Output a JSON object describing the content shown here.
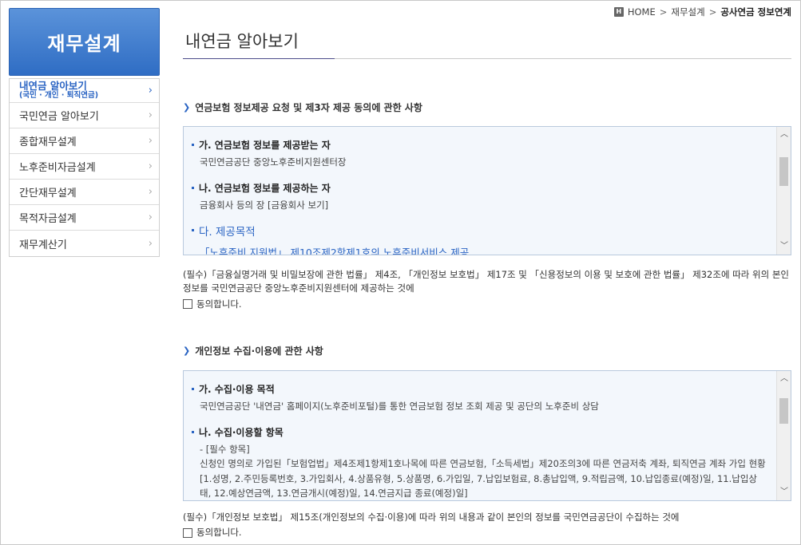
{
  "sidebar": {
    "title": "재무설계",
    "active_label": "내연금 알아보기",
    "active_sub": "(국민 · 개인 · 퇴직연금)",
    "items": [
      "국민연금 알아보기",
      "종합재무설계",
      "노후준비자금설계",
      "간단재무설계",
      "목적자금설계",
      "재무계산기"
    ]
  },
  "breadcrumb": {
    "home_icon": "H",
    "home": "HOME",
    "sep": ">",
    "level1": "재무설계",
    "current": "공사연금 정보연계"
  },
  "page": {
    "title": "내연금 알아보기"
  },
  "section1": {
    "heading": "연금보험 정보제공 요청 및 제3자 제공 동의에 관한 사항",
    "items": [
      {
        "head": "가. 연금보험 정보를 제공받는 자",
        "text": "국민연금공단 중앙노후준비지원센터장"
      },
      {
        "head": "나. 연금보험 정보를 제공하는 자",
        "text": "금융회사 등의 장 [금융회사 보기]"
      },
      {
        "head": "다. 제공목적",
        "text": "「노후준비 지원법」 제10조제2항제1호의 노후준비서비스 제공"
      }
    ],
    "consent": "(필수)「금융실명거래 및 비밀보장에 관한 법률」 제4조, 「개인정보 보호법」 제17조 및 「신용정보의 이용 및 보호에 관한 법률」 제32조에 따라 위의 본인 정보를 국민연금공단 중앙노후준비지원센터에 제공하는 것에",
    "agree": "동의합니다."
  },
  "section2": {
    "heading": "개인정보 수집·이용에 관한 사항",
    "items": [
      {
        "head": "가. 수집·이용 목적",
        "text": "국민연금공단 '내연금' 홈페이지(노후준비포털)를 통한 연금보험 정보 조회 제공 및 공단의 노후준비 상담"
      },
      {
        "head": "나. 수집·이용할 항목",
        "text1": "- [필수 항목]",
        "text2": "신청인 명의로 가입된「보험업법」제4조제1항제1호나목에 따른 연금보험,「소득세법」제20조의3에 따른 연금저축 계좌, 퇴직연금 계좌 가입 현황",
        "text3": "[1.성명, 2.주민등록번호, 3.가입회사, 4.상품유형, 5.상품명, 6.가입일, 7.납입보험료, 8.총납입액, 9.적립금액, 10.납입종료(예정)일, 11.납입상태, 12.예상연금액, 13.연금개시(예정)일, 14.연금지급 종료(예정)일]"
      }
    ],
    "consent": "(필수)「개인정보 보호법」 제15조(개인정보의 수집·이용)에 따라 위의 내용과 같이 본인의 정보를 국민연금공단이 수집하는 것에",
    "agree": "동의합니다."
  },
  "icons": {
    "chevron_right": "›",
    "scroll_up": "︿",
    "scroll_down": "﹀",
    "section_arrow": "❯"
  }
}
